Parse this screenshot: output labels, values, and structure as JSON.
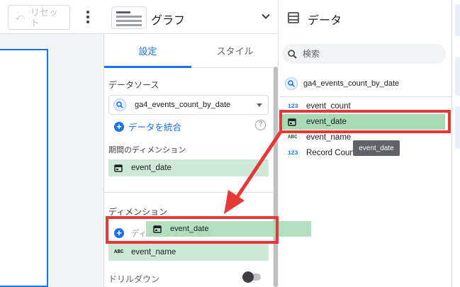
{
  "toolbar": {
    "reset_label": "リセット",
    "reset_icon": "undo-icon",
    "more_icon": "more-vert-icon"
  },
  "properties": {
    "chart_type": "グラフ",
    "chart_type_icon": "table-chart-icon",
    "tabs": [
      {
        "label": "設定",
        "active": true
      },
      {
        "label": "スタイル",
        "active": false
      }
    ],
    "data_source_label": "データソース",
    "data_source_value": "ga4_events_count_by_date",
    "blend_label": "データを統合",
    "date_range_dimension_label": "期間のディメンション",
    "date_range_dimension_value": "event_date",
    "dimension_label": "ディメンション",
    "add_dimension_label": "ディメンションを追加",
    "dimensions": [
      {
        "type": "ABC",
        "name": "event_name"
      }
    ],
    "drilldown_label": "ドリルダウン",
    "drilldown_enabled": false
  },
  "data_panel": {
    "title": "データ",
    "search_placeholder": "検索",
    "data_source_value": "ga4_events_count_by_date",
    "fields": [
      {
        "type": "123",
        "name": "event_count"
      },
      {
        "type": "date",
        "name": "event_date"
      },
      {
        "type": "ABC",
        "name": "event_name"
      },
      {
        "type": "123",
        "name": "Record Count"
      }
    ]
  },
  "drag": {
    "tooltip": "event_date",
    "ghost_label": "event_date"
  },
  "colors": {
    "accent": "#1a73e8",
    "chip_green": "#ceead6",
    "annotation_red": "#e53935"
  }
}
